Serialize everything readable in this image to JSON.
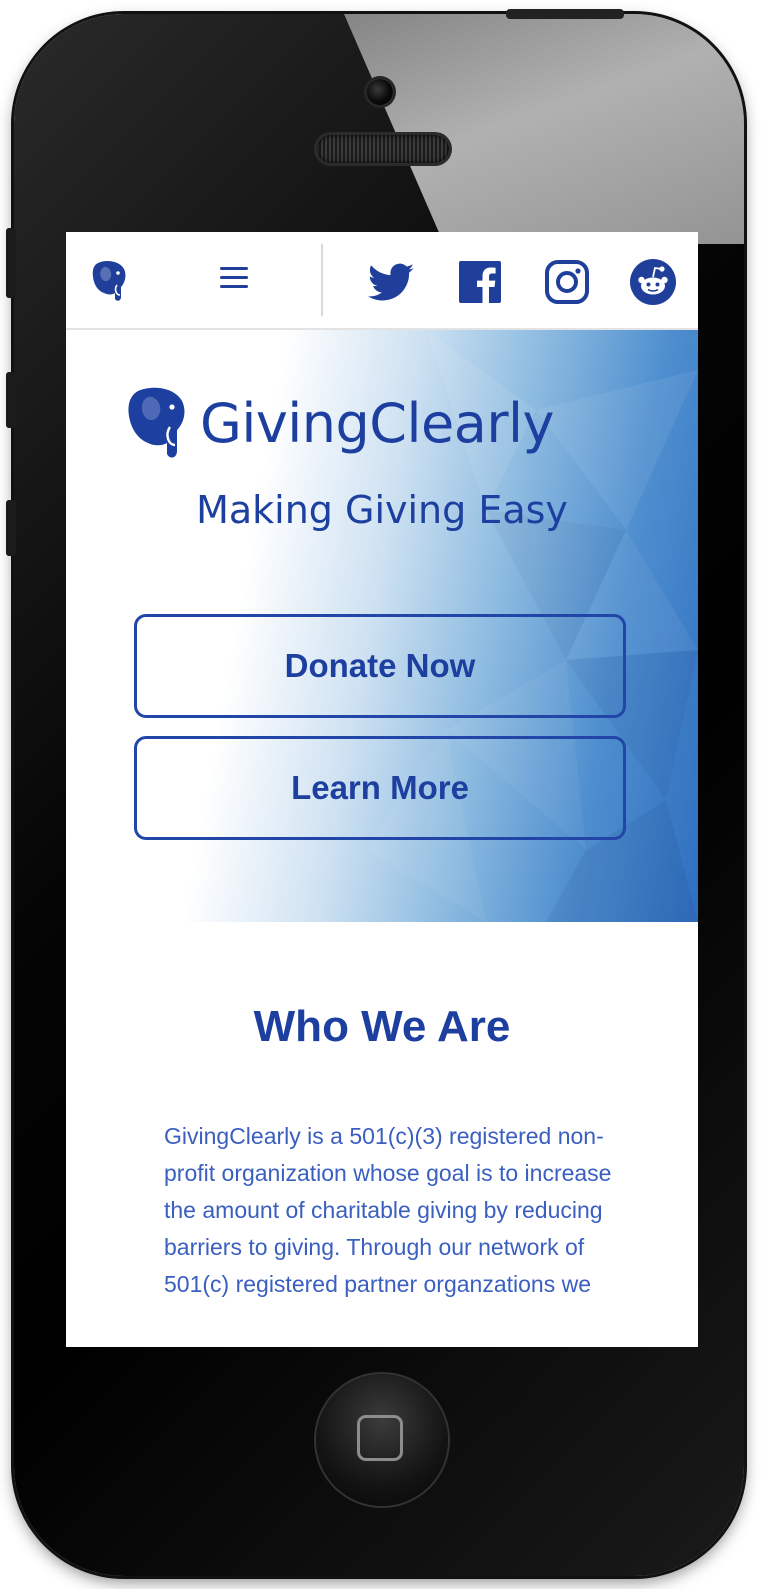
{
  "nav": {
    "logo_icon": "elephant-icon",
    "menu_icon": "hamburger-menu-icon",
    "social": [
      "twitter-icon",
      "facebook-icon",
      "instagram-icon",
      "reddit-icon"
    ]
  },
  "hero": {
    "brand_name": "GivingClearly",
    "tagline": "Making Giving Easy",
    "donate_label": "Donate Now",
    "learn_label": "Learn More"
  },
  "about": {
    "title": "Who We Are",
    "body": "GivingClearly is a 501(c)(3) registered non-profit organization whose goal is to increase the amount of charitable giving by reducing barriers to giving. Through our network of 501(c) registered partner organzations we"
  },
  "colors": {
    "brand_blue": "#1d3fa0",
    "text_blue": "#3a5fc0",
    "hero_gradient_end": "#2f6fbf"
  }
}
